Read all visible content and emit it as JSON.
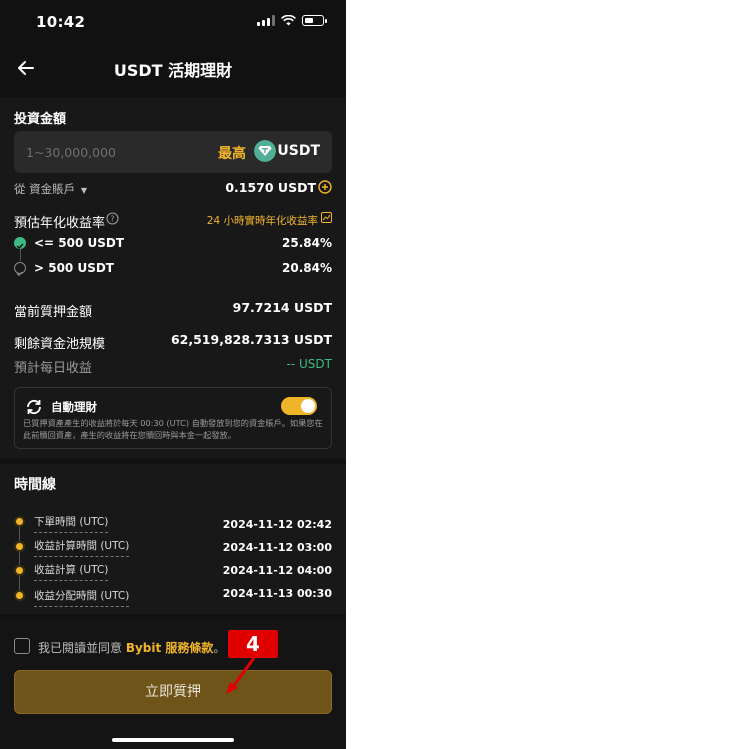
{
  "status": {
    "time": "10:42"
  },
  "nav": {
    "title": "USDT 活期理財"
  },
  "invest": {
    "section_label": "投資金額",
    "input_placeholder": "1~30,000,000",
    "max_label": "最高",
    "unit": "USDT",
    "from_account_label": "從 資金賬戶",
    "balance": "0.1570 USDT"
  },
  "apr": {
    "label": "預估年化收益率",
    "realtime_link": "24 小時實時年化收益率",
    "tiers": [
      {
        "label": "<= 500  USDT",
        "value": "25.84%"
      },
      {
        "label": "> 500  USDT",
        "value": "20.84%"
      }
    ]
  },
  "stats": [
    {
      "label": "當前質押金額",
      "value": "97.7214 USDT"
    },
    {
      "label": "剩餘資金池規模",
      "value": "62,519,828.7313 USDT"
    },
    {
      "label": "預計每日收益",
      "value": "-- USDT"
    }
  ],
  "auto": {
    "title": "自動理財",
    "desc": "已質押資產產生的收益將於每天 00:30 (UTC) 自動發放到您的資金賬戶。如果您在此前贖回資產，產生的收益將在您贖回時與本金一起發放。",
    "enabled": true
  },
  "timeline": {
    "title": "時間線",
    "items": [
      {
        "label": "下單時間 (UTC)",
        "value": "2024-11-12 02:42"
      },
      {
        "label": "收益計算時間 (UTC)",
        "value": "2024-11-12 03:00"
      },
      {
        "label": "收益計算 (UTC)",
        "value": "2024-11-12 04:00"
      },
      {
        "label": "收益分配時間 (UTC)",
        "value": "2024-11-13 00:30"
      }
    ]
  },
  "agree": {
    "prefix": "我已閱讀並同意 ",
    "link": "Bybit 服務條款",
    "suffix": "。"
  },
  "cta": {
    "label": "立即質押"
  },
  "annotation": {
    "step": "4"
  },
  "colors": {
    "accent": "#f0b429",
    "positive": "#3dbb84",
    "background": "#111111"
  }
}
